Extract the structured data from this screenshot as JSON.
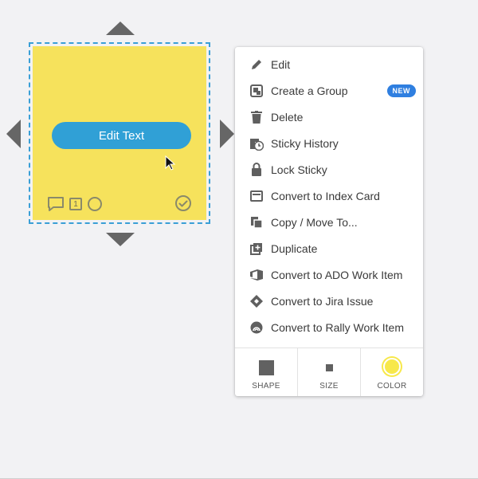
{
  "sticky": {
    "edit_text_label": "Edit Text",
    "comment_count": "1",
    "color": "#f6e25c"
  },
  "menu": {
    "items": [
      {
        "label": "Edit",
        "icon": "pencil-icon"
      },
      {
        "label": "Create a Group",
        "icon": "group-icon",
        "badge": "NEW"
      },
      {
        "label": "Delete",
        "icon": "trash-icon"
      },
      {
        "label": "Sticky History",
        "icon": "history-icon"
      },
      {
        "label": "Lock Sticky",
        "icon": "lock-icon"
      },
      {
        "label": "Convert to Index Card",
        "icon": "index-card-icon"
      },
      {
        "label": "Copy / Move To...",
        "icon": "copy-move-icon"
      },
      {
        "label": "Duplicate",
        "icon": "duplicate-icon"
      },
      {
        "label": "Convert to ADO Work Item",
        "icon": "ado-icon"
      },
      {
        "label": "Convert to Jira Issue",
        "icon": "jira-icon"
      },
      {
        "label": "Convert to Rally Work Item",
        "icon": "rally-icon"
      }
    ],
    "footer": {
      "shape_label": "SHAPE",
      "size_label": "SIZE",
      "color_label": "COLOR"
    }
  },
  "colors": {
    "accent": "#30a0d6",
    "badge": "#2f7fe0",
    "selection": "#3a9fd6",
    "current_color": "#f7e84a"
  }
}
